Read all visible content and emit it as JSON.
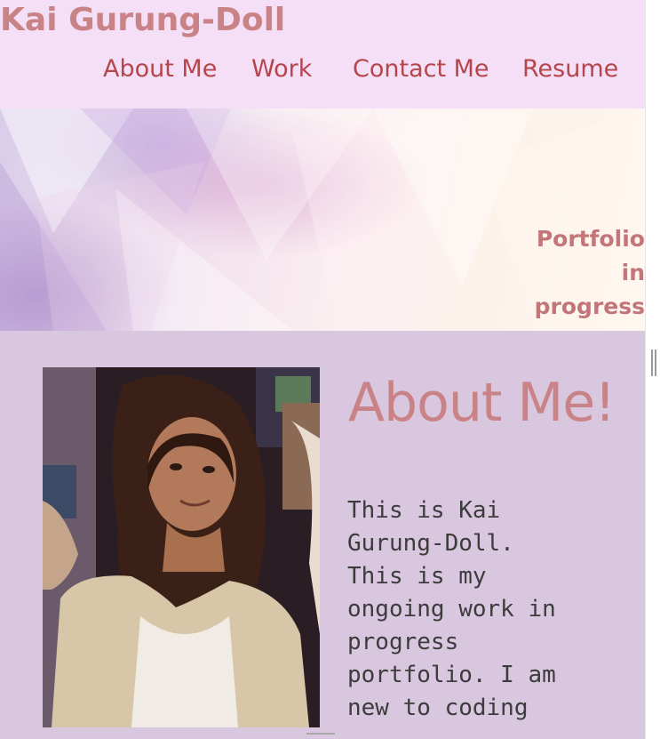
{
  "header": {
    "site_title": "Kai Gurung-Doll",
    "nav": [
      {
        "label": "About Me"
      },
      {
        "label": "Work"
      },
      {
        "label": "Contact Me"
      },
      {
        "label": "Resume"
      }
    ]
  },
  "hero": {
    "tagline": "Portfolio\nin\nprogress"
  },
  "about": {
    "heading": "About Me!",
    "portrait_alt": "Photo of Kai Gurung-Doll",
    "bio": "This is Kai\nGurung-Doll.\nThis is my\nongoing work in\nprogress\nportfolio. I am\nnew to coding"
  },
  "colors": {
    "header_bg": "#f4dff6",
    "title": "#c98386",
    "nav_link": "#b4464c",
    "content_bg": "#d9c7e0",
    "body_text": "#3c3c3c"
  }
}
